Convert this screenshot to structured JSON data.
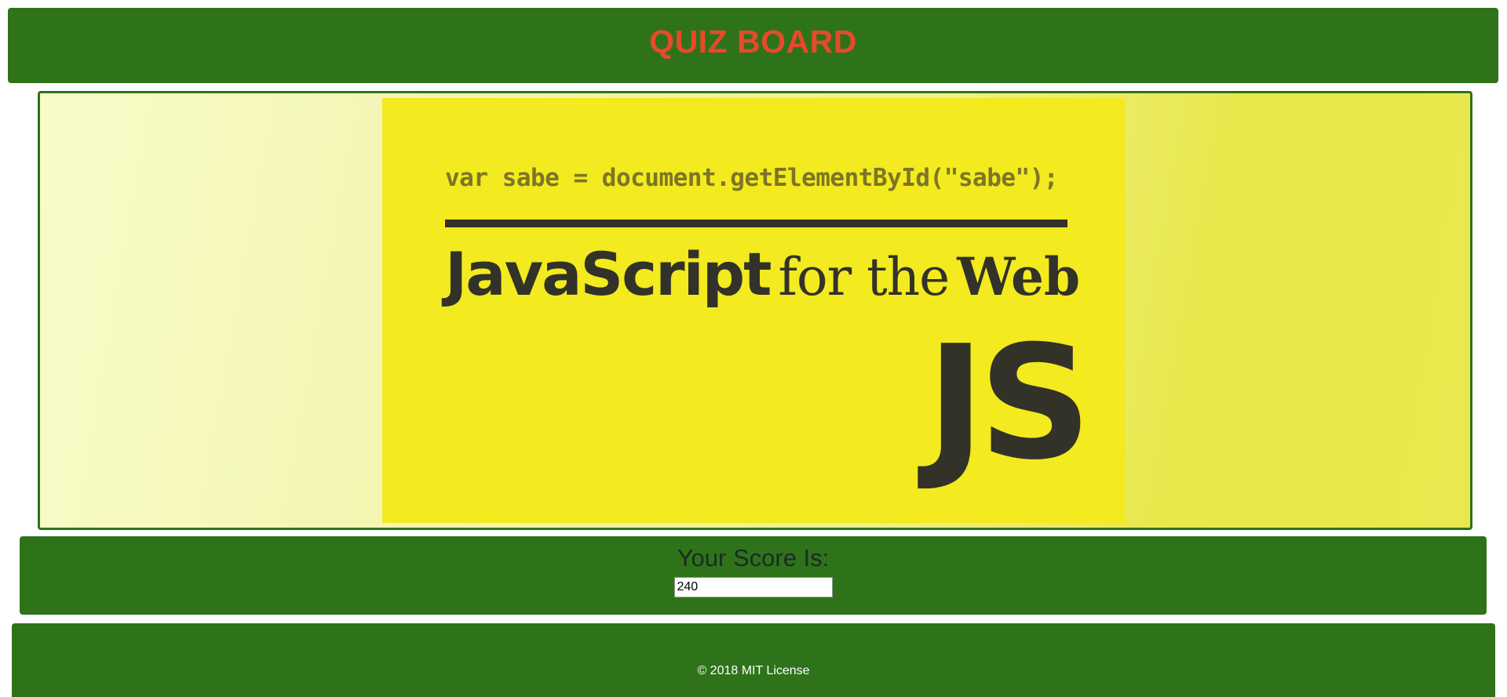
{
  "header": {
    "title": "QUIZ BOARD"
  },
  "banner": {
    "code_line": "var sabe = document.getElementById(\"sabe\");",
    "title_js": "JavaScript",
    "title_for_the": "for the",
    "title_web": "Web",
    "logo": "JS"
  },
  "score": {
    "label": "Your Score Is:",
    "value": "240"
  },
  "footer": {
    "text": "© 2018 MIT License"
  },
  "colors": {
    "panel_green": "#2e731a",
    "title_red": "#e8492b",
    "banner_yellow": "#f3ea1f",
    "banner_dark": "#323229"
  }
}
